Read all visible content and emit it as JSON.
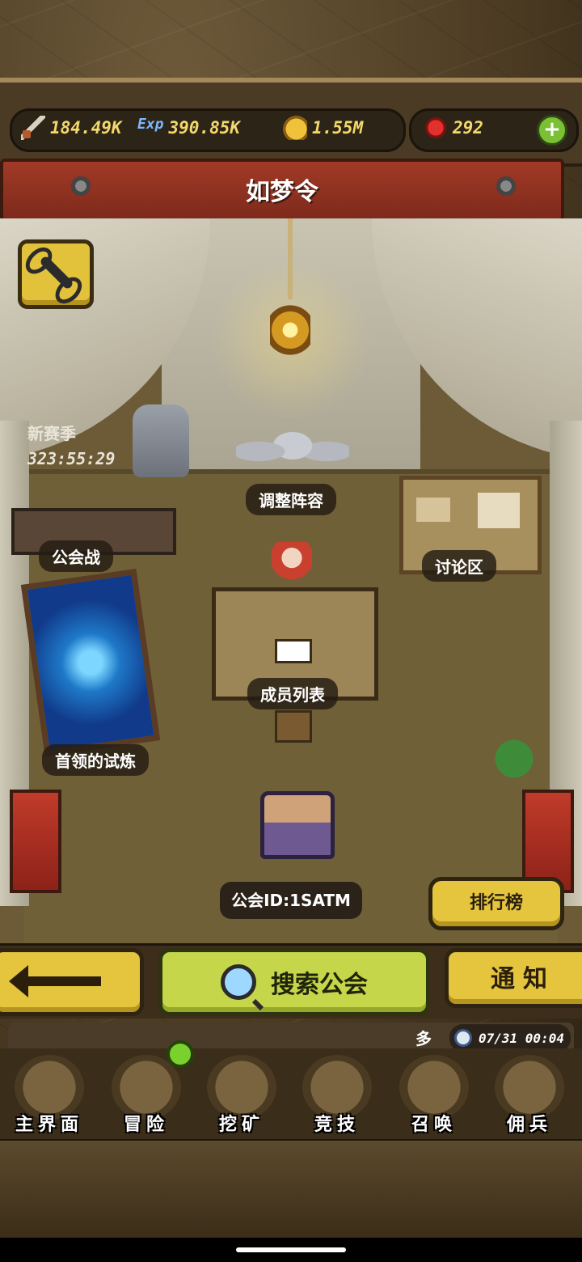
{
  "resources": {
    "attack": "184.49K",
    "exp_label": "Exp",
    "exp": "390.85K",
    "gold": "1.55M",
    "gems": "292",
    "add_label": "+"
  },
  "header": {
    "title": "如梦令"
  },
  "season": {
    "title": "新赛季",
    "timer": "323:55:29"
  },
  "scene_labels": {
    "adjust_lineup": "调整阵容",
    "guild_war": "公会战",
    "discussion": "讨论区",
    "member_list": "成员列表",
    "boss_trial": "首领的试炼"
  },
  "guild_id": "公会ID:1SATM",
  "buttons": {
    "ranking": "排行榜",
    "search_guild": "搜索公会",
    "notice": "通知"
  },
  "status": {
    "multi": "多",
    "datetime": "07/31 00:04"
  },
  "nav": [
    {
      "label": "主界面",
      "icon": "scroll-map-icon"
    },
    {
      "label": "冒险",
      "icon": "island-icon"
    },
    {
      "label": "挖矿",
      "icon": "pickaxe-icon"
    },
    {
      "label": "竞技",
      "icon": "crossed-swords-icon"
    },
    {
      "label": "召唤",
      "icon": "summon-scroll-icon"
    },
    {
      "label": "佣兵",
      "icon": "tent-icon"
    }
  ],
  "colors": {
    "accent_yellow": "#e4c53d",
    "accent_green": "#c6d64a",
    "ribbon_red": "#a13a26",
    "resource_text": "#f3d86a"
  }
}
